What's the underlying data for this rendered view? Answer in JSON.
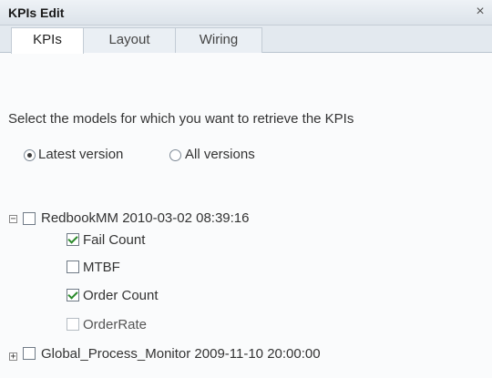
{
  "dialog": {
    "title": "KPIs Edit",
    "close_glyph": "×"
  },
  "tabs": [
    {
      "label": "KPIs",
      "active": true
    },
    {
      "label": "Layout",
      "active": false
    },
    {
      "label": "Wiring",
      "active": false
    }
  ],
  "instruction": "Select the models for which you want to retrieve the KPIs",
  "version_options": [
    {
      "label": "Latest version",
      "selected": true
    },
    {
      "label": "All versions",
      "selected": false
    }
  ],
  "tree": [
    {
      "expander": "−",
      "label": "RedbookMM 2010-03-02 08:39:16",
      "checked": false,
      "children": [
        {
          "label": "Fail Count",
          "checked": true
        },
        {
          "label": "MTBF",
          "checked": false
        },
        {
          "label": "Order Count",
          "checked": true
        },
        {
          "label": "OrderRate",
          "checked": false,
          "disabled": true
        }
      ]
    },
    {
      "expander": "+",
      "label": "Global_Process_Monitor 2009-11-10 20:00:00",
      "checked": false
    }
  ]
}
